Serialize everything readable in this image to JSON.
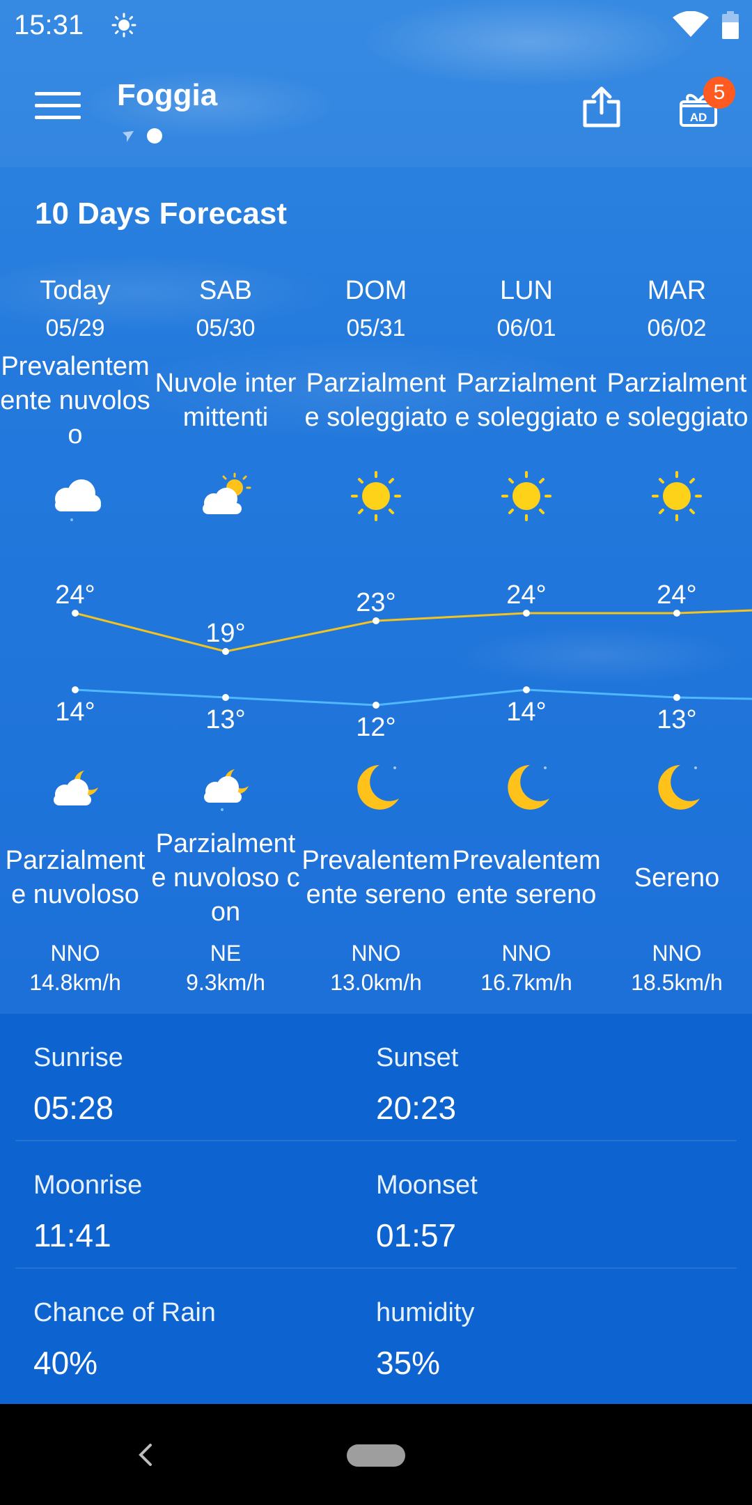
{
  "status": {
    "time": "15:31"
  },
  "header": {
    "city": "Foggia",
    "ad_badge": "5"
  },
  "section_title": "10 Days Forecast",
  "days": [
    {
      "name": "Today",
      "date": "05/29",
      "day_condition": "Prevalentemente nuvoloso",
      "day_icon": "cloud-icon",
      "high": "24°",
      "low": "14°",
      "night_icon": "cloud-moon-icon",
      "night_condition": "Parzialmente nuvoloso",
      "wind_dir": "NNO",
      "wind_speed": "14.8km/h"
    },
    {
      "name": "SAB",
      "date": "05/30",
      "day_condition": "Nuvole intermittenti",
      "day_icon": "cloud-sun-icon",
      "high": "19°",
      "low": "13°",
      "night_icon": "cloud-moon-rain-icon",
      "night_condition": "Parzialmente nuvoloso con",
      "wind_dir": "NE",
      "wind_speed": "9.3km/h"
    },
    {
      "name": "DOM",
      "date": "05/31",
      "day_condition": "Parzialmente soleggiato",
      "day_icon": "sun-icon",
      "high": "23°",
      "low": "12°",
      "night_icon": "moon-icon",
      "night_condition": "Prevalentemente sereno",
      "wind_dir": "NNO",
      "wind_speed": "13.0km/h"
    },
    {
      "name": "LUN",
      "date": "06/01",
      "day_condition": "Parzialmente soleggiato",
      "day_icon": "sun-icon",
      "high": "24°",
      "low": "14°",
      "night_icon": "moon-icon",
      "night_condition": "Prevalentemente sereno",
      "wind_dir": "NNO",
      "wind_speed": "16.7km/h"
    },
    {
      "name": "MAR",
      "date": "06/02",
      "day_condition": "Parzialmente soleggiato",
      "day_icon": "sun-icon",
      "high": "24°",
      "low": "13°",
      "night_icon": "moon-icon",
      "night_condition": "Sereno",
      "wind_dir": "NNO",
      "wind_speed": "18.5km/h"
    }
  ],
  "chart_data": {
    "type": "line",
    "categories": [
      "05/29",
      "05/30",
      "05/31",
      "06/01",
      "06/02"
    ],
    "series": [
      {
        "values": [
          24,
          19,
          23,
          24,
          24
        ],
        "color": "#f2c321"
      },
      {
        "values": [
          14,
          13,
          12,
          14,
          13
        ],
        "color": "#4fb8ff"
      }
    ]
  },
  "details": {
    "sunrise_label": "Sunrise",
    "sunrise": "05:28",
    "sunset_label": "Sunset",
    "sunset": "20:23",
    "moonrise_label": "Moonrise",
    "moonrise": "11:41",
    "moonset_label": "Moonset",
    "moonset": "01:57",
    "rain_label": "Chance of Rain",
    "rain": "40%",
    "humidity_label": "humidity",
    "humidity": "35%"
  }
}
